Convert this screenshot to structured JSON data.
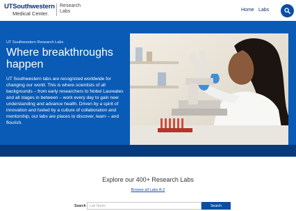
{
  "header": {
    "logo_main": "UTSouthwestern",
    "logo_sub": "Medical Center.",
    "section_line1": "Research",
    "section_line2": "Labs",
    "nav": {
      "home": "Home",
      "labs": "Labs"
    },
    "search_icon": "search-icon"
  },
  "hero": {
    "eyebrow": "UT Southwestern Research Labs",
    "headline_line1": "Where breakthroughs",
    "headline_line2": "happen",
    "body": "UT Southwestern labs are recognized worldwide for changing our world. This is where scientists of all backgrounds – from early researchers to Nobel Laureates and all stages in between – work every day to gain new understanding and advance health. Driven by a spirit of innovation and fueled by a culture of collaboration and mentorship, our labs are places to discover, learn – and flourish.",
    "background_color": "#0a5bb5"
  },
  "explore": {
    "title": "Explore our 400+ Research Labs",
    "browse_link": "Browse all Labs A-Z",
    "search_label": "Search",
    "search_placeholder": "Lab Name",
    "search_value": "",
    "search_button": "Search"
  },
  "colors": {
    "brand_navy": "#0a2e6e",
    "accent_blue": "#0a4ea4"
  }
}
